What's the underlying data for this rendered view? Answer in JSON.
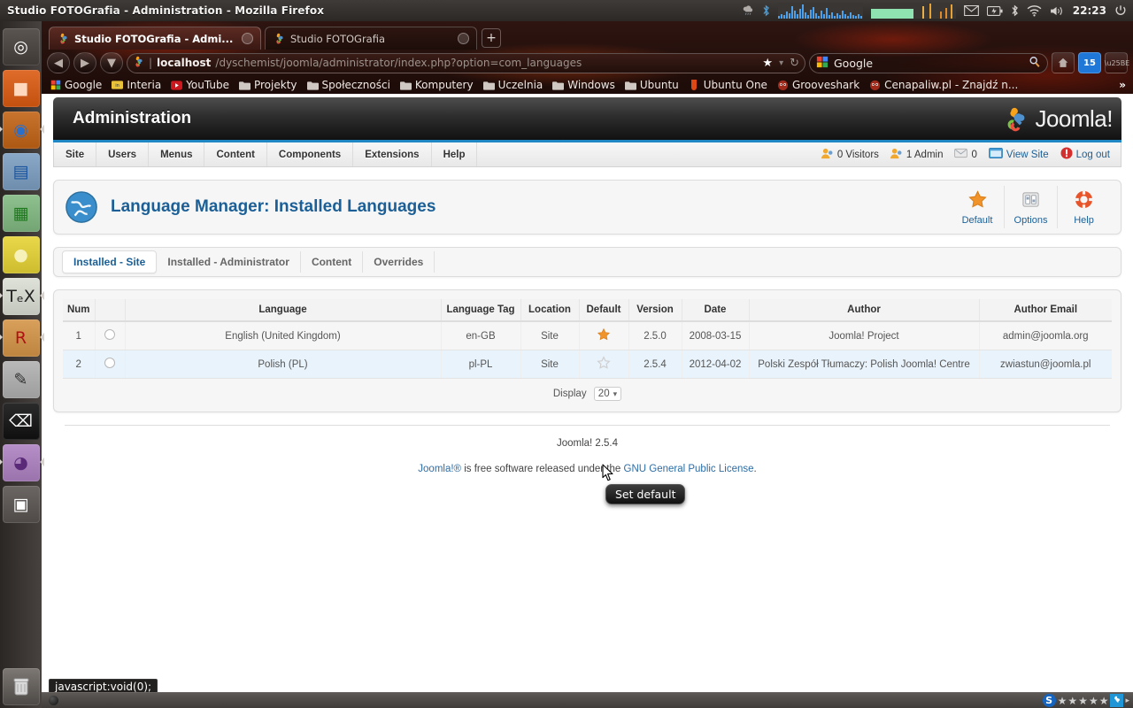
{
  "window": {
    "title": "Studio FOTOGrafia - Administration - Mozilla Firefox"
  },
  "unity_panel": {
    "clock": "22:23",
    "tray_icons": [
      "weather-icon",
      "bluetooth-icon",
      "cpu-graph-icon",
      "network-graph-icon",
      "mail-icon",
      "battery-icon",
      "bluetooth-icon",
      "wifi-icon",
      "volume-icon"
    ],
    "power_icon": "power-icon"
  },
  "launcher": {
    "items": [
      {
        "name": "ubuntu-dash",
        "glyph": "◎",
        "bg": "#5a5551",
        "fg": "#ffffff"
      },
      {
        "name": "files-nautilus",
        "glyph": "■",
        "bg": "#e06c2b",
        "fg": "#ffd9bd"
      },
      {
        "name": "firefox",
        "glyph": "◉",
        "bg": "#c9742e",
        "fg": "#2a6fc9",
        "pinned": true
      },
      {
        "name": "libreoffice-writer",
        "glyph": "▤",
        "bg": "#8aa8c8",
        "fg": "#18539c"
      },
      {
        "name": "libreoffice-calc",
        "glyph": "▦",
        "bg": "#8fc08f",
        "fg": "#1f7a1f"
      },
      {
        "name": "ubuntu-one",
        "glyph": "●",
        "bg": "#e8d84a",
        "fg": "#f6f1b8"
      },
      {
        "name": "texmaker",
        "glyph": "TₑX",
        "bg": "#dfe2d8",
        "fg": "#222222",
        "pinned": true
      },
      {
        "name": "rkward",
        "glyph": "R",
        "bg": "#d9a05b",
        "fg": "#b01313",
        "pinned": true
      },
      {
        "name": "text-editor",
        "glyph": "✎",
        "bg": "#b9b9b9",
        "fg": "#333333"
      },
      {
        "name": "terminal",
        "glyph": "⌫",
        "bg": "#2b2b2b",
        "fg": "#ffffff"
      },
      {
        "name": "pidgin-messenger",
        "glyph": "◕",
        "bg": "#b68fc8",
        "fg": "#5a2a78",
        "pinned": true
      },
      {
        "name": "workspace-switcher",
        "glyph": "▣",
        "bg": "#6b6663",
        "fg": "#ffffff"
      }
    ],
    "trash": {
      "name": "trash-icon",
      "glyph": "🗑"
    }
  },
  "browser": {
    "tabs": [
      {
        "label": "Studio FOTOGrafia - Admi...",
        "favicon": "joomla-favicon",
        "active": true
      },
      {
        "label": "Studio FOTOGrafia",
        "favicon": "joomla-favicon",
        "active": false
      }
    ],
    "new_tab_label": "+",
    "back_glyph": "◀",
    "forward_glyph": "▶",
    "stop_glyph": "▼",
    "url": {
      "favicon": "joomla-favicon",
      "host": "localhost",
      "path": "/dyschemist/joomla/administrator/index.php?option=com_languages",
      "bookmark_glyph": "★",
      "dropdown_glyph": "▾",
      "reload_glyph": "↻"
    },
    "search": {
      "engine": "Google",
      "placeholder": "Google",
      "icon": "google-icon",
      "magnifier": "search-icon"
    },
    "toolbar_buttons": [
      {
        "name": "home-button",
        "glyph": "⌂"
      },
      {
        "name": "calendar-button",
        "glyph": "15"
      },
      {
        "name": "addon-button",
        "glyph": "◐"
      }
    ],
    "bookmarks": [
      {
        "label": "Google",
        "icon": "google-icon"
      },
      {
        "label": "Interia",
        "icon": "interia-icon"
      },
      {
        "label": "YouTube",
        "icon": "youtube-icon"
      },
      {
        "label": "Projekty",
        "icon": "folder-icon"
      },
      {
        "label": "Społeczności",
        "icon": "folder-icon"
      },
      {
        "label": "Komputery",
        "icon": "folder-icon"
      },
      {
        "label": "Uczelnia",
        "icon": "folder-icon"
      },
      {
        "label": "Windows",
        "icon": "folder-icon"
      },
      {
        "label": "Ubuntu",
        "icon": "folder-icon"
      },
      {
        "label": "Ubuntu One",
        "icon": "ubuntu-one-icon"
      },
      {
        "label": "Grooveshark",
        "icon": "grooveshark-icon"
      },
      {
        "label": "Cenapaliw.pl - Znajdź n...",
        "icon": "cenapaliw-icon"
      }
    ],
    "bookmarks_overflow": "»",
    "status_text": "javascript:void(0);",
    "addonbar": {
      "s_badge": "S",
      "stars": 5,
      "star_glyph": "★",
      "joomla_badge": "joomla-icon",
      "arrow": "▸"
    }
  },
  "joomla": {
    "header_title": "Administration",
    "logo_text": "Joomla!",
    "menu": [
      {
        "label": "Site",
        "name": "menu-site"
      },
      {
        "label": "Users",
        "name": "menu-users"
      },
      {
        "label": "Menus",
        "name": "menu-menus"
      },
      {
        "label": "Content",
        "name": "menu-content"
      },
      {
        "label": "Components",
        "name": "menu-components"
      },
      {
        "label": "Extensions",
        "name": "menu-extensions"
      },
      {
        "label": "Help",
        "name": "menu-help"
      }
    ],
    "status_items": [
      {
        "label": "0 Visitors",
        "icon": "visitors-icon",
        "name": "visitors-status"
      },
      {
        "label": "1 Admin",
        "icon": "admin-icon",
        "name": "admin-status"
      },
      {
        "label": "0",
        "icon": "messages-icon",
        "name": "messages-status"
      },
      {
        "label": "View Site",
        "icon": "view-site-icon",
        "name": "view-site-link"
      },
      {
        "label": "Log out",
        "icon": "logout-icon",
        "name": "logout-link"
      }
    ],
    "page_title": "Language Manager: Installed Languages",
    "page_icon": "globe-icon",
    "toolbar": [
      {
        "label": "Default",
        "icon": "star-icon",
        "name": "default-button"
      },
      {
        "label": "Options",
        "icon": "options-icon",
        "name": "options-button"
      },
      {
        "label": "Help",
        "icon": "lifering-icon",
        "name": "help-button"
      }
    ],
    "tabs": [
      {
        "label": "Installed - Site",
        "active": true,
        "name": "tab-installed-site"
      },
      {
        "label": "Installed - Administrator",
        "active": false,
        "name": "tab-installed-administrator"
      },
      {
        "label": "Content",
        "active": false,
        "name": "tab-content"
      },
      {
        "label": "Overrides",
        "active": false,
        "name": "tab-overrides"
      }
    ],
    "table": {
      "columns": [
        "Num",
        "",
        "Language",
        "Language Tag",
        "Location",
        "Default",
        "Version",
        "Date",
        "Author",
        "Author Email"
      ],
      "rows": [
        {
          "num": "1",
          "language": "English (United Kingdom)",
          "tag": "en-GB",
          "location": "Site",
          "default": true,
          "version": "2.5.0",
          "date": "2008-03-15",
          "author": "Joomla! Project",
          "email": "admin@joomla.org"
        },
        {
          "num": "2",
          "language": "Polish (PL)",
          "tag": "pl-PL",
          "location": "Site",
          "default": false,
          "version": "2.5.4",
          "date": "2012-04-02",
          "author": "Polski Zespół Tłumaczy: Polish Joomla! Centre",
          "email": "zwiastun@joomla.pl"
        }
      ],
      "display_label": "Display",
      "display_value": "20",
      "display_chevron": "▾"
    },
    "tooltip": "Set default",
    "footer": {
      "version": "Joomla! 2.5.4",
      "license_prefix": "Joomla!®",
      "license_mid": " is free software released under the ",
      "license_link": "GNU General Public License",
      "license_suffix": "."
    }
  },
  "colors": {
    "joomla_blue": "#1b5f96",
    "accent_bar": "#1f87c4",
    "star_on": "#f0932b",
    "star_off": "#d8d8d8",
    "row_alt": "#e9f3fb"
  }
}
